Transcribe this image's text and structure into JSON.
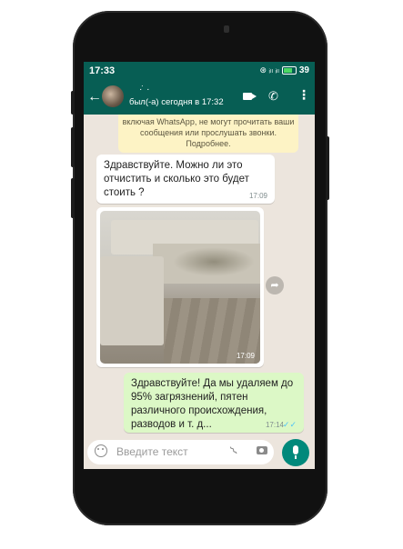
{
  "status_bar": {
    "time": "17:33",
    "icons": "⊛ ᵢₗₗ ᵢₗₗ",
    "battery_level": "39"
  },
  "header": {
    "contact_name": "·̇ ·",
    "last_seen": "был(-а) сегодня в 17:32"
  },
  "chat": {
    "notice": "включая WhatsApp, не могут прочитать ваши сообщения или прослушать звонки. Подробнее.",
    "messages": [
      {
        "direction": "in",
        "text": "Здравствуйте. Можно ли это отчистить и сколько это будет стоить ?",
        "time": "17:09"
      },
      {
        "direction": "in",
        "type": "photo",
        "time": "17:09"
      },
      {
        "direction": "out",
        "text": "Здравствуйте! Да мы удаляем до 95% загрязнений,  пятен различного происхождения, разводов и т. д...",
        "time": "17:14",
        "ticks": "✓✓"
      }
    ]
  },
  "input": {
    "placeholder": "Введите текст"
  },
  "colors": {
    "header": "#075e54",
    "outgoing_bubble": "#dcf8c6",
    "incoming_bubble": "#ffffff",
    "notice_bg": "#fdf3c5",
    "mic_button": "#00897b",
    "read_ticks": "#4fc3f7"
  },
  "icons": [
    "back-arrow-icon",
    "avatar",
    "video-call-icon",
    "phone-call-icon",
    "menu-dots-icon",
    "share-icon",
    "emoji-icon",
    "attach-icon",
    "camera-icon",
    "mic-icon"
  ]
}
